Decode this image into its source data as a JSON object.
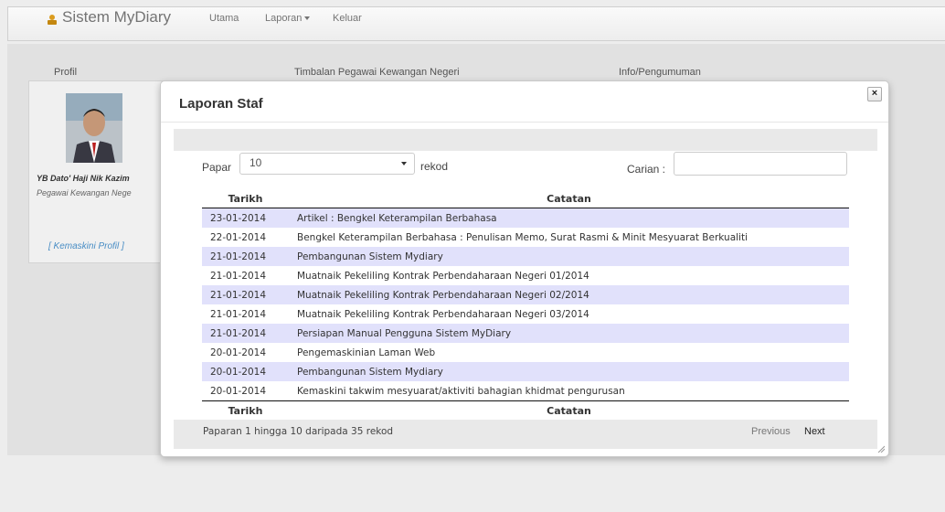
{
  "navbar": {
    "brand": "Sistem MyDiary",
    "items": [
      {
        "label": "Utama"
      },
      {
        "label": "Laporan"
      },
      {
        "label": "Keluar"
      }
    ]
  },
  "page": {
    "sections": [
      "Profil",
      "Timbalan Pegawai Kewangan Negeri",
      "Info/Pengumuman"
    ],
    "profile": {
      "name": "YB Dato' Haji Nik Kazim",
      "role": "Pegawai Kewangan Nege",
      "edit_link": "[ Kemaskini Profil ]"
    }
  },
  "modal": {
    "title": "Laporan Staf",
    "close_label": "×",
    "show_label": "Papar",
    "page_size": "10",
    "records_label": "rekod",
    "search_label": "Carian :",
    "search_value": "",
    "columns": [
      "Tarikh",
      "Catatan"
    ],
    "rows": [
      {
        "date": "23-01-2014",
        "note": "Artikel : Bengkel Keterampilan Berbahasa"
      },
      {
        "date": "22-01-2014",
        "note": "Bengkel Keterampilan Berbahasa : Penulisan Memo, Surat Rasmi & Minit Mesyuarat Berkualiti"
      },
      {
        "date": "21-01-2014",
        "note": "Pembangunan Sistem Mydiary"
      },
      {
        "date": "21-01-2014",
        "note": "Muatnaik Pekeliling Kontrak Perbendaharaan Negeri 01/2014"
      },
      {
        "date": "21-01-2014",
        "note": "Muatnaik Pekeliling Kontrak Perbendaharaan Negeri 02/2014"
      },
      {
        "date": "21-01-2014",
        "note": "Muatnaik Pekeliling Kontrak Perbendaharaan Negeri 03/2014"
      },
      {
        "date": "21-01-2014",
        "note": "Persiapan Manual Pengguna Sistem MyDiary"
      },
      {
        "date": "20-01-2014",
        "note": "Pengemaskinian Laman Web"
      },
      {
        "date": "20-01-2014",
        "note": "Pembangunan Sistem Mydiary"
      },
      {
        "date": "20-01-2014",
        "note": "Kemaskini takwim mesyuarat/aktiviti bahagian khidmat pengurusan"
      }
    ],
    "info": "Paparan 1 hingga 10 daripada 35 rekod",
    "prev_label": "Previous",
    "next_label": "Next"
  },
  "colors": {
    "odd_row": "#e1e1fb",
    "link": "#4a90c9"
  }
}
